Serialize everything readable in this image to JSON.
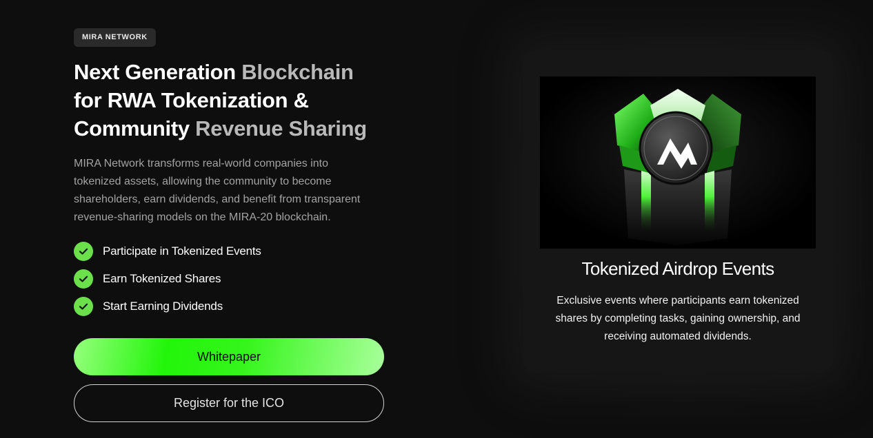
{
  "badge": "MIRA NETWORK",
  "headline": {
    "line1_white": "Next Generation ",
    "line1_grey": "Blockchain",
    "line2_white": "for RWA Tokenization &",
    "line3_white": "Community ",
    "line3_grey": "Revenue Sharing"
  },
  "description": "MIRA Network transforms real-world companies into tokenized assets, allowing the community to become shareholders, earn dividends, and benefit from transparent revenue-sharing models on the MIRA-20 blockchain.",
  "features": [
    {
      "label": "Participate in Tokenized Events",
      "icon": "check-icon"
    },
    {
      "label": "Earn Tokenized Shares",
      "icon": "check-icon"
    },
    {
      "label": "Start Earning Dividends",
      "icon": "check-icon"
    }
  ],
  "buttons": {
    "primary_label": "Whitepaper",
    "secondary_label": "Register for the ICO"
  },
  "card": {
    "image_icon": "mira-logo-crown-icon",
    "title": "Tokenized Airdrop Events",
    "description": "Exclusive events where participants earn tokenized shares by completing tasks, gaining ownership, and receiving automated dividends."
  },
  "colors": {
    "background": "#0e0e0e",
    "accent_green": "#22f50a",
    "check_green": "#6be04a",
    "card_background": "#161616"
  }
}
